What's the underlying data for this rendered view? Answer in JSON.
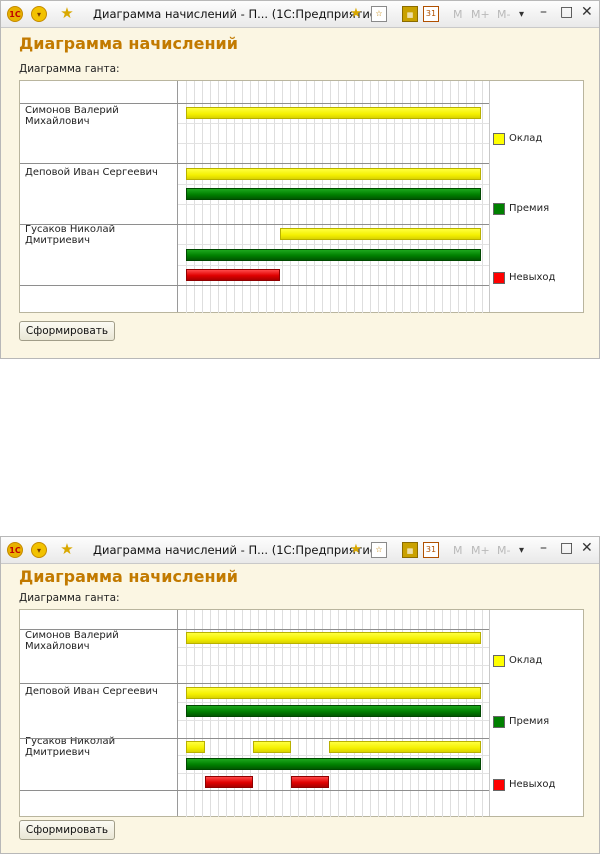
{
  "windows": [
    {
      "title": "Диаграмма начислений - П...  (1С:Предприятие)",
      "form_title": "Диаграмма начислений",
      "gantt_label": "Диаграмма ганта:",
      "employees": [
        "Симонов Валерий Михайлович",
        "Деповой Иван Сергеевич",
        "Гусаков Николай Дмитриевич"
      ],
      "legend": [
        {
          "label": "Оклад",
          "color": "#ffff00"
        },
        {
          "label": "Премия",
          "color": "#008000"
        },
        {
          "label": "Невыход",
          "color": "#ff0000"
        }
      ],
      "button": "Сформировать",
      "toolbar": {
        "logo": "1С",
        "m": "M",
        "m_plus": "M+",
        "m_minus": "M-",
        "minimize": "–",
        "maximize": "□",
        "close": "✕"
      }
    },
    {
      "title": "Диаграмма начислений - П...  (1С:Предприятие)",
      "form_title": "Диаграмма начислений",
      "gantt_label": "Диаграмма ганта:",
      "employees": [
        "Симонов Валерий Михайлович",
        "Деповой Иван Сергеевич",
        "Гусаков Николай Дмитриевич"
      ],
      "legend": [
        {
          "label": "Оклад",
          "color": "#ffff00"
        },
        {
          "label": "Премия",
          "color": "#008000"
        },
        {
          "label": "Невыход",
          "color": "#ff0000"
        }
      ],
      "button": "Сформировать",
      "toolbar": {
        "logo": "1С",
        "m": "M",
        "m_plus": "M+",
        "m_minus": "M-",
        "minimize": "–",
        "maximize": "□",
        "close": "✕"
      }
    }
  ],
  "chart_data": [
    {
      "type": "gantt",
      "series": [
        {
          "name": "Оклад",
          "employee": "Симонов Валерий Михайлович",
          "intervals": [
            [
              0,
              1
            ]
          ]
        },
        {
          "name": "Оклад",
          "employee": "Деповой Иван Сергеевич",
          "intervals": [
            [
              0,
              1
            ]
          ]
        },
        {
          "name": "Премия",
          "employee": "Деповой Иван Сергеевич",
          "intervals": [
            [
              0,
              1
            ]
          ]
        },
        {
          "name": "Оклад",
          "employee": "Гусаков Николай Дмитриевич",
          "intervals": [
            [
              0.32,
              1
            ]
          ]
        },
        {
          "name": "Премия",
          "employee": "Гусаков Николай Дмитриевич",
          "intervals": [
            [
              0,
              1
            ]
          ]
        },
        {
          "name": "Невыход",
          "employee": "Гусаков Николай Дмитриевич",
          "intervals": [
            [
              0,
              0.32
            ]
          ]
        }
      ]
    },
    {
      "type": "gantt",
      "series": [
        {
          "name": "Оклад",
          "employee": "Симонов Валерий Михайлович",
          "intervals": [
            [
              0,
              1
            ]
          ]
        },
        {
          "name": "Оклад",
          "employee": "Деповой Иван Сергеевич",
          "intervals": [
            [
              0,
              1
            ]
          ]
        },
        {
          "name": "Премия",
          "employee": "Деповой Иван Сергеевич",
          "intervals": [
            [
              0,
              1
            ]
          ]
        },
        {
          "name": "Оклад",
          "employee": "Гусаков Николай Дмитриевич",
          "intervals": [
            [
              0,
              0.065
            ],
            [
              0.226,
              0.355
            ],
            [
              0.484,
              1
            ]
          ]
        },
        {
          "name": "Премия",
          "employee": "Гусаков Николай Дмитриевич",
          "intervals": [
            [
              0,
              1
            ]
          ]
        },
        {
          "name": "Невыход",
          "employee": "Гусаков Николай Дмитриевич",
          "intervals": [
            [
              0.065,
              0.226
            ],
            [
              0.355,
              0.484
            ]
          ]
        }
      ]
    }
  ]
}
